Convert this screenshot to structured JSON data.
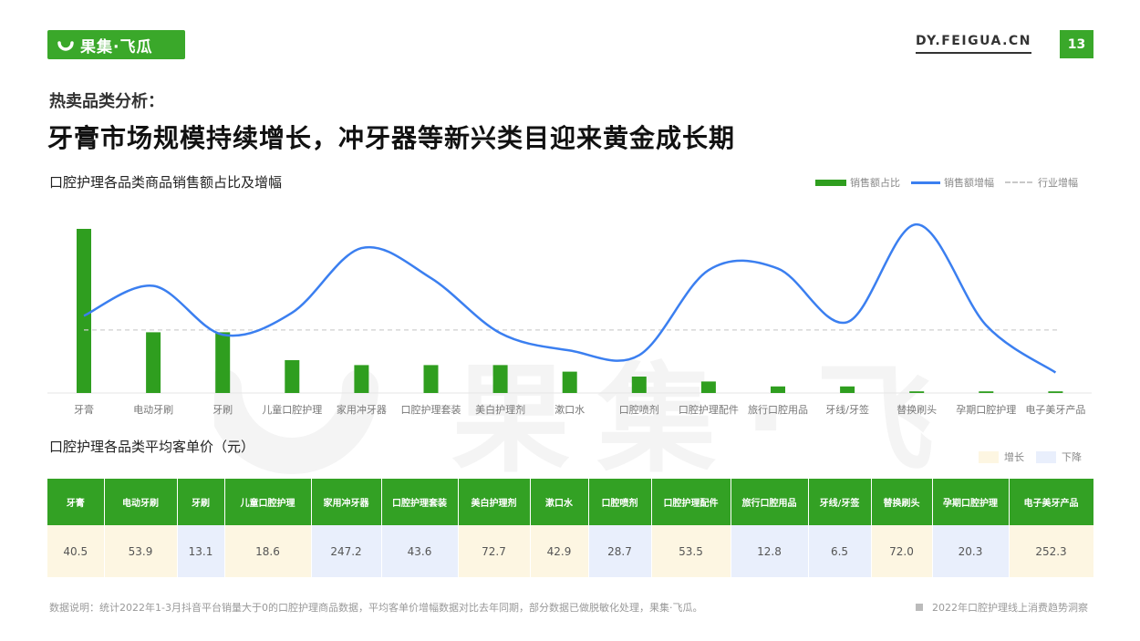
{
  "header": {
    "logo_text": "果集·飞瓜",
    "site": "DY.FEIGUA.CN",
    "page_number": "13"
  },
  "subtitle": "热卖品类分析：",
  "title": "牙膏市场规模持续增长，冲牙器等新兴类目迎来黄金成长期",
  "chart_title": "口腔护理各品类商品销售额占比及增幅",
  "legend": {
    "bar": "销售额占比",
    "line": "销售额增幅",
    "dash": "行业增幅"
  },
  "colors": {
    "bar": "#2f9e1f",
    "line": "#3b7ff0",
    "header": "#33a124",
    "up": "#fdf6e2",
    "down": "#e9effc"
  },
  "chart_data": {
    "type": "bar",
    "categories": [
      "牙膏",
      "电动牙刷",
      "牙刷",
      "儿童口腔护理",
      "家用冲牙器",
      "口腔护理套装",
      "美白护理剂",
      "漱口水",
      "口腔喷剂",
      "口腔护理配件",
      "旅行口腔用品",
      "牙线/牙签",
      "替换刷头",
      "孕期口腔护理",
      "电子美牙产品"
    ],
    "series": [
      {
        "name": "销售额占比",
        "type": "bar",
        "values": [
          100,
          37,
          37,
          20,
          17,
          17,
          17,
          13,
          10,
          7,
          4,
          4,
          1,
          1,
          1
        ]
      },
      {
        "name": "销售额增幅",
        "type": "line",
        "values": [
          49,
          68,
          37,
          51,
          92,
          73,
          38,
          27,
          24,
          78,
          79,
          45,
          107,
          43,
          13
        ]
      },
      {
        "name": "行业增幅",
        "type": "reference",
        "value": 40
      }
    ],
    "ylim": [
      0,
      110
    ],
    "grid": false,
    "legend_position": "top-right"
  },
  "table_title": "口腔护理各品类平均客单价（元）",
  "table_legend": {
    "up": "增长",
    "down": "下降"
  },
  "table": {
    "headers": [
      "牙膏",
      "电动牙刷",
      "牙刷",
      "儿童口腔护理",
      "家用冲牙器",
      "口腔护理套装",
      "美白护理剂",
      "漱口水",
      "口腔喷剂",
      "口腔护理配件",
      "旅行口腔用品",
      "牙线/牙签",
      "替换刷头",
      "孕期口腔护理",
      "电子美牙产品"
    ],
    "values": [
      "40.5",
      "53.9",
      "13.1",
      "18.6",
      "247.2",
      "43.6",
      "72.7",
      "42.9",
      "28.7",
      "53.5",
      "12.8",
      "6.5",
      "72.0",
      "20.3",
      "252.3"
    ],
    "trend": [
      "up",
      "up",
      "down",
      "up",
      "down",
      "down",
      "up",
      "up",
      "down",
      "up",
      "down",
      "down",
      "up",
      "down",
      "up"
    ]
  },
  "note": "数据说明：统计2022年1-3月抖音平台销量大于0的口腔护理商品数据，平均客单价增幅数据对比去年同期，部分数据已做脱敏化处理，果集·飞瓜。",
  "footer_right": "2022年口腔护理线上消费趋势洞察",
  "watermark_text": "果集·飞瓜"
}
